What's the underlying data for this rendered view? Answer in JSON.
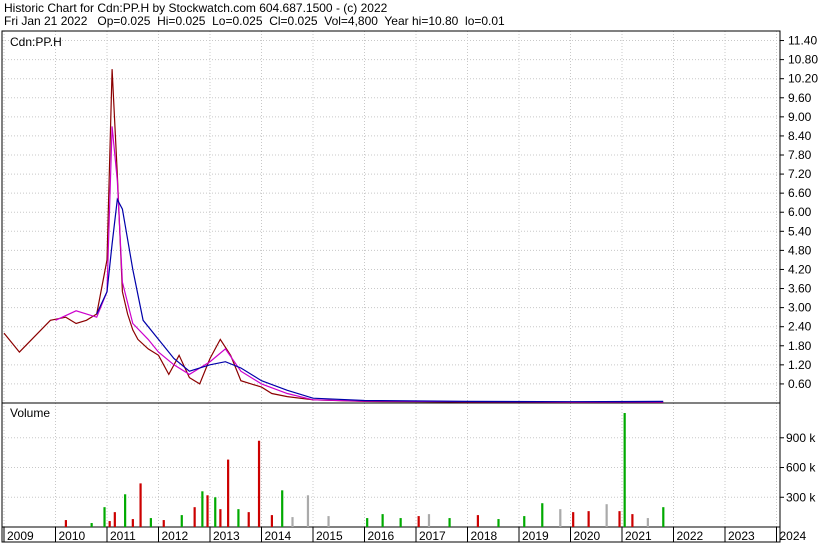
{
  "header": {
    "title": "Historic Chart for Cdn:PP.H by Stockwatch.com 604.687.1500 - (c) 2022",
    "quote": "Fri Jan 21 2022   Op=0.025  Hi=0.025  Lo=0.025  Cl=0.025  Vol=4,800  Year hi=10.80  lo=0.01"
  },
  "chart_data": {
    "type": "line",
    "price_panel": {
      "label": "Cdn:PP.H",
      "yticks": [
        "0.60",
        "1.20",
        "1.80",
        "2.40",
        "3.00",
        "3.60",
        "4.20",
        "4.80",
        "5.40",
        "6.00",
        "6.60",
        "7.20",
        "7.80",
        "8.40",
        "9.00",
        "9.60",
        "10.20",
        "10.80",
        "11.40"
      ],
      "ylim": [
        0,
        11.7
      ],
      "series": [
        {
          "color": "#8b0000",
          "x": [
            2009.0,
            2009.3,
            2009.6,
            2009.9,
            2010.2,
            2010.4,
            2010.6,
            2010.8,
            2011.0,
            2011.1,
            2011.2,
            2011.3,
            2011.4,
            2011.5,
            2011.6,
            2011.8,
            2012.0,
            2012.2,
            2012.4,
            2012.6,
            2012.8,
            2013.0,
            2013.2,
            2013.4,
            2013.6,
            2013.8,
            2014.0,
            2014.2,
            2014.5,
            2015.0,
            2016.0,
            2017.0,
            2018.0,
            2019.0,
            2020.0,
            2021.0,
            2021.8
          ],
          "values": [
            2.2,
            1.6,
            2.1,
            2.6,
            2.7,
            2.5,
            2.6,
            2.8,
            4.5,
            10.5,
            7.2,
            3.5,
            2.8,
            2.3,
            2.0,
            1.7,
            1.5,
            0.9,
            1.5,
            0.8,
            0.6,
            1.4,
            2.0,
            1.5,
            0.7,
            0.6,
            0.5,
            0.3,
            0.2,
            0.1,
            0.05,
            0.04,
            0.03,
            0.03,
            0.02,
            0.03,
            0.025
          ]
        },
        {
          "color": "#cc00cc",
          "x": [
            2010.0,
            2010.4,
            2010.8,
            2011.0,
            2011.1,
            2011.2,
            2011.3,
            2011.5,
            2011.8,
            2012.0,
            2012.3,
            2012.6,
            2013.0,
            2013.3,
            2013.6,
            2014.0,
            2014.5,
            2015.0,
            2016.0,
            2018.0,
            2020.0,
            2021.8
          ],
          "values": [
            2.6,
            2.9,
            2.7,
            3.5,
            8.7,
            7.0,
            3.8,
            2.5,
            2.0,
            1.6,
            1.2,
            0.9,
            1.3,
            1.7,
            1.0,
            0.6,
            0.3,
            0.1,
            0.06,
            0.04,
            0.03,
            0.03
          ]
        },
        {
          "color": "#0000aa",
          "x": [
            2010.8,
            2011.0,
            2011.1,
            2011.2,
            2011.3,
            2011.5,
            2011.7,
            2012.0,
            2012.3,
            2012.6,
            2013.0,
            2013.3,
            2013.6,
            2014.0,
            2014.5,
            2015.0,
            2016.0,
            2018.0,
            2020.0,
            2021.8
          ],
          "values": [
            2.8,
            3.5,
            5.0,
            6.4,
            6.1,
            4.2,
            2.6,
            2.0,
            1.4,
            1.0,
            1.2,
            1.3,
            1.1,
            0.7,
            0.4,
            0.15,
            0.08,
            0.05,
            0.04,
            0.05
          ]
        }
      ]
    },
    "volume_panel": {
      "label": "Volume",
      "yticks": [
        "300 k",
        "600 k",
        "900 k"
      ],
      "ylim": [
        0,
        1150000
      ],
      "bars": [
        {
          "x": 2010.2,
          "value": 70000,
          "color": "#cc0000"
        },
        {
          "x": 2010.7,
          "value": 40000,
          "color": "#00aa00"
        },
        {
          "x": 2010.95,
          "value": 200000,
          "color": "#00aa00"
        },
        {
          "x": 2011.05,
          "value": 60000,
          "color": "#cc0000"
        },
        {
          "x": 2011.15,
          "value": 150000,
          "color": "#cc0000"
        },
        {
          "x": 2011.35,
          "value": 330000,
          "color": "#00aa00"
        },
        {
          "x": 2011.5,
          "value": 80000,
          "color": "#cc0000"
        },
        {
          "x": 2011.65,
          "value": 440000,
          "color": "#cc0000"
        },
        {
          "x": 2011.85,
          "value": 90000,
          "color": "#00aa00"
        },
        {
          "x": 2012.1,
          "value": 70000,
          "color": "#cc0000"
        },
        {
          "x": 2012.45,
          "value": 120000,
          "color": "#00aa00"
        },
        {
          "x": 2012.7,
          "value": 200000,
          "color": "#cc0000"
        },
        {
          "x": 2012.85,
          "value": 360000,
          "color": "#00aa00"
        },
        {
          "x": 2012.95,
          "value": 320000,
          "color": "#cc0000"
        },
        {
          "x": 2013.1,
          "value": 300000,
          "color": "#00aa00"
        },
        {
          "x": 2013.2,
          "value": 180000,
          "color": "#cc0000"
        },
        {
          "x": 2013.35,
          "value": 680000,
          "color": "#cc0000"
        },
        {
          "x": 2013.55,
          "value": 180000,
          "color": "#00aa00"
        },
        {
          "x": 2013.75,
          "value": 150000,
          "color": "#cc0000"
        },
        {
          "x": 2013.95,
          "value": 870000,
          "color": "#cc0000"
        },
        {
          "x": 2014.2,
          "value": 120000,
          "color": "#cc0000"
        },
        {
          "x": 2014.4,
          "value": 370000,
          "color": "#00aa00"
        },
        {
          "x": 2014.6,
          "value": 100000,
          "color": "#aaaaaa"
        },
        {
          "x": 2014.9,
          "value": 320000,
          "color": "#aaaaaa"
        },
        {
          "x": 2015.3,
          "value": 110000,
          "color": "#aaaaaa"
        },
        {
          "x": 2016.05,
          "value": 90000,
          "color": "#00aa00"
        },
        {
          "x": 2016.35,
          "value": 130000,
          "color": "#00aa00"
        },
        {
          "x": 2016.7,
          "value": 90000,
          "color": "#00aa00"
        },
        {
          "x": 2017.05,
          "value": 110000,
          "color": "#cc0000"
        },
        {
          "x": 2017.25,
          "value": 130000,
          "color": "#aaaaaa"
        },
        {
          "x": 2017.65,
          "value": 90000,
          "color": "#00aa00"
        },
        {
          "x": 2018.2,
          "value": 120000,
          "color": "#cc0000"
        },
        {
          "x": 2018.6,
          "value": 80000,
          "color": "#00aa00"
        },
        {
          "x": 2019.1,
          "value": 110000,
          "color": "#00aa00"
        },
        {
          "x": 2019.45,
          "value": 240000,
          "color": "#00aa00"
        },
        {
          "x": 2019.8,
          "value": 180000,
          "color": "#aaaaaa"
        },
        {
          "x": 2020.05,
          "value": 150000,
          "color": "#cc0000"
        },
        {
          "x": 2020.35,
          "value": 160000,
          "color": "#cc0000"
        },
        {
          "x": 2020.7,
          "value": 230000,
          "color": "#aaaaaa"
        },
        {
          "x": 2020.95,
          "value": 160000,
          "color": "#cc0000"
        },
        {
          "x": 2021.05,
          "value": 1150000,
          "color": "#00aa00"
        },
        {
          "x": 2021.2,
          "value": 130000,
          "color": "#cc0000"
        },
        {
          "x": 2021.5,
          "value": 90000,
          "color": "#aaaaaa"
        },
        {
          "x": 2021.8,
          "value": 200000,
          "color": "#00aa00"
        }
      ]
    },
    "xticks": [
      "2009",
      "2010",
      "2011",
      "2012",
      "2013",
      "2014",
      "2015",
      "2016",
      "2017",
      "2018",
      "2019",
      "2020",
      "2021",
      "2022",
      "2023",
      "2024"
    ],
    "grid": true
  }
}
